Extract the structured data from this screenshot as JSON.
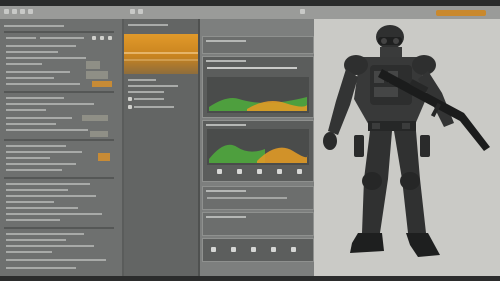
{
  "app": {
    "title": ""
  },
  "viewport": {
    "subject": "armored-soldier-figure"
  },
  "colors": {
    "accent": "#c9892e",
    "chart_green": "#4fae3c",
    "chart_orange": "#e09a26",
    "panel_dark": "#6e706f",
    "viewport_bg": "#cacac6"
  },
  "icons": [
    "menu-icon",
    "search-icon",
    "gear-icon",
    "play-icon",
    "grid-icon",
    "image-icon",
    "camera-icon"
  ]
}
